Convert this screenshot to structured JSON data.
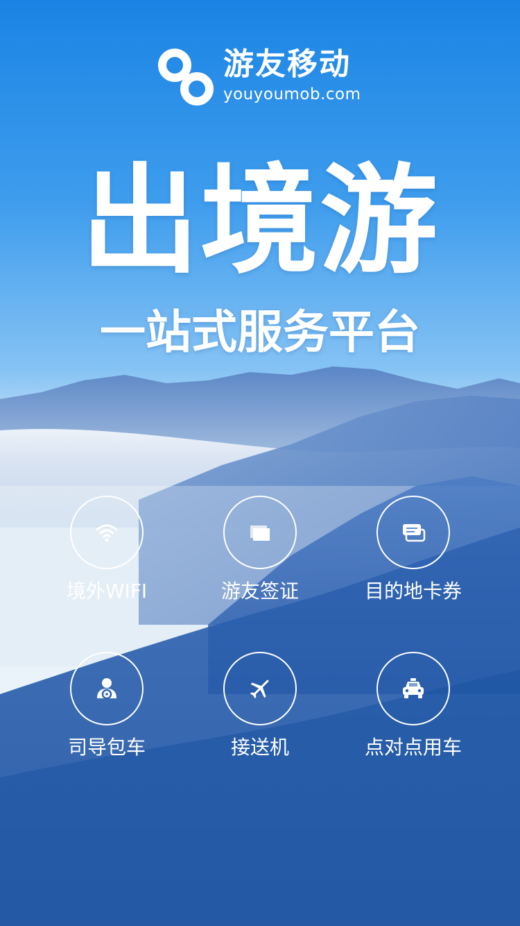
{
  "brand": {
    "name": "游友移动",
    "url": "youyoumob.com"
  },
  "hero": {
    "headline": "出境游",
    "tagline": "一站式服务平台"
  },
  "services": [
    {
      "label": "境外WIFI",
      "icon": "wifi-icon"
    },
    {
      "label": "游友签证",
      "icon": "folder-icon"
    },
    {
      "label": "目的地卡券",
      "icon": "tickets-icon"
    },
    {
      "label": "司导包车",
      "icon": "driver-icon"
    },
    {
      "label": "接送机",
      "icon": "airplane-icon"
    },
    {
      "label": "点对点用车",
      "icon": "taxi-icon"
    }
  ],
  "colors": {
    "sky_top": "#1a84e4",
    "mountain_dark": "#1a4f9e",
    "text": "#ffffff"
  }
}
